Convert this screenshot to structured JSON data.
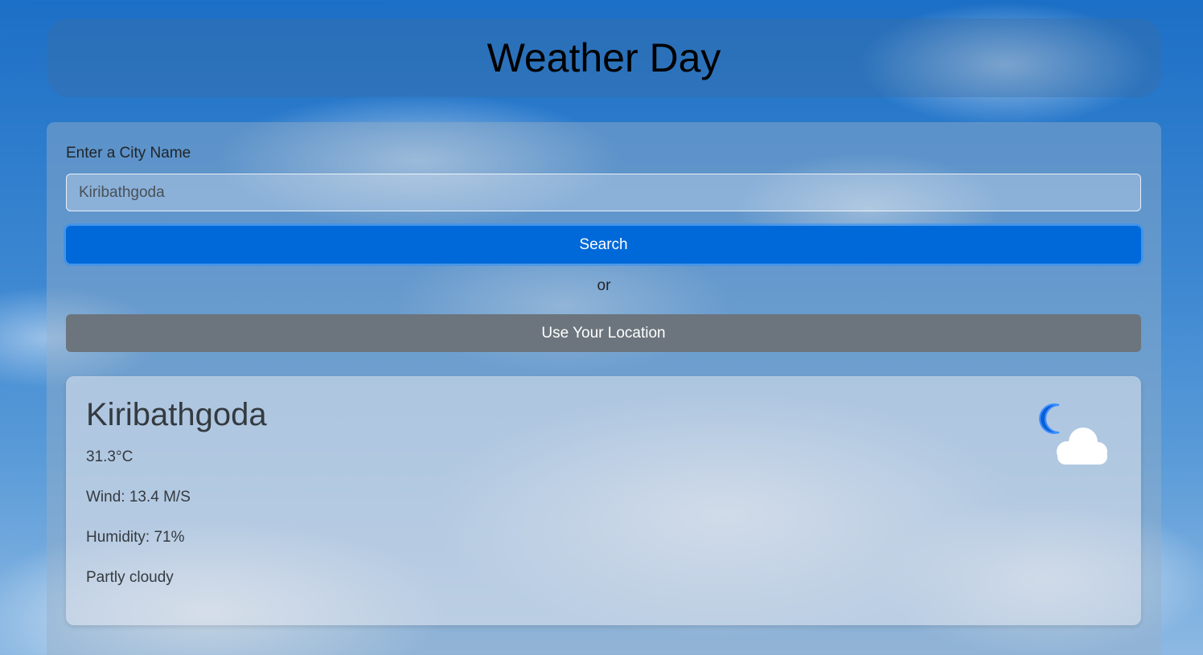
{
  "header": {
    "title": "Weather Day"
  },
  "search": {
    "label": "Enter a City Name",
    "value": "Kiribathgoda",
    "button_label": "Search",
    "separator": "or",
    "location_button_label": "Use Your Location"
  },
  "weather": {
    "city": "Kiribathgoda",
    "temperature": "31.3°C",
    "wind": "Wind: 13.4 M/S",
    "humidity": "Humidity: 71%",
    "condition": "Partly cloudy",
    "icon": "night-partly-cloudy-icon"
  },
  "colors": {
    "search_button": "#0069d9",
    "location_button": "#6c757d"
  }
}
